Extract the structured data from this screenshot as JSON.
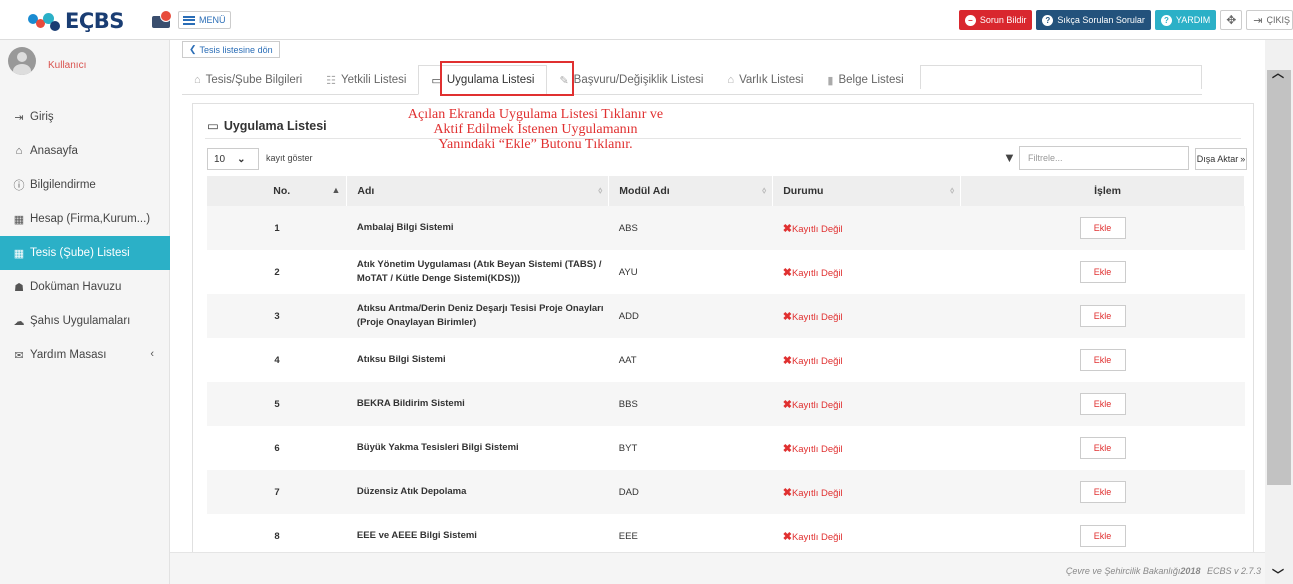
{
  "header": {
    "logo_text": "EÇBS",
    "menu_label": "MENÜ",
    "buttons": {
      "report_issue": "Sorun Bildir",
      "faq": "Sıkça Sorulan Sorular",
      "help": "YARDIM",
      "logout": "ÇIKIŞ"
    }
  },
  "sidebar": {
    "user_name": "Kullanıcı",
    "items": [
      {
        "label": "Giriş",
        "icon": "login-icon"
      },
      {
        "label": "Anasayfa",
        "icon": "home-icon"
      },
      {
        "label": "Bilgilendirme",
        "icon": "info-icon"
      },
      {
        "label": "Hesap (Firma,Kurum...)",
        "icon": "building-icon"
      },
      {
        "label": "Tesis (Şube) Listesi",
        "icon": "building-icon",
        "active": true
      },
      {
        "label": "Doküman Havuzu",
        "icon": "users-icon"
      },
      {
        "label": "Şahıs Uygulamaları",
        "icon": "cloud-icon"
      },
      {
        "label": "Yardım Masası",
        "icon": "envelope-icon"
      }
    ]
  },
  "main": {
    "back_label": "Tesis listesine dön",
    "tabs": [
      {
        "label": "Tesis/Şube Bilgileri"
      },
      {
        "label": "Yetkili Listesi"
      },
      {
        "label": "Uygulama Listesi",
        "active": true
      },
      {
        "label": "Başvuru/Değişiklik Listesi"
      },
      {
        "label": "Varlık Listesi"
      },
      {
        "label": "Belge Listesi"
      }
    ],
    "panel_title": "Uygulama Listesi",
    "annotation": [
      "Açılan Ekranda Uygulama Listesi Tıklanır ve",
      "Aktif Edilmek İstenen Uygulamanın",
      "Yanındaki “Ekle” Butonu Tıklanır."
    ],
    "page_length": "10",
    "page_length_label": "kayıt göster",
    "filter_placeholder": "Filtrele...",
    "export_label": "Dışa Aktar",
    "columns": {
      "no": "No.",
      "name": "Adı",
      "module": "Modül Adı",
      "status": "Durumu",
      "action": "İşlem"
    },
    "rows": [
      {
        "no": "1",
        "name": "Ambalaj Bilgi Sistemi",
        "module": "ABS",
        "status": "Kayıtlı Değil",
        "action": "Ekle"
      },
      {
        "no": "2",
        "name": "Atık Yönetim Uygulaması (Atık Beyan Sistemi (TABS) / MoTAT / Kütle Denge Sistemi(KDS)))",
        "module": "AYU",
        "status": "Kayıtlı Değil",
        "action": "Ekle"
      },
      {
        "no": "3",
        "name": "Atıksu Arıtma/Derin Deniz Deşarjı Tesisi Proje Onayları (Proje Onaylayan Birimler)",
        "module": "ADD",
        "status": "Kayıtlı Değil",
        "action": "Ekle"
      },
      {
        "no": "4",
        "name": "Atıksu Bilgi Sistemi",
        "module": "AAT",
        "status": "Kayıtlı Değil",
        "action": "Ekle"
      },
      {
        "no": "5",
        "name": "BEKRA Bildirim Sistemi",
        "module": "BBS",
        "status": "Kayıtlı Değil",
        "action": "Ekle"
      },
      {
        "no": "6",
        "name": "Büyük Yakma Tesisleri Bilgi Sistemi",
        "module": "BYT",
        "status": "Kayıtlı Değil",
        "action": "Ekle"
      },
      {
        "no": "7",
        "name": "Düzensiz Atık Depolama",
        "module": "DAD",
        "status": "Kayıtlı Değil",
        "action": "Ekle"
      },
      {
        "no": "8",
        "name": "EEE ve AEEE Bilgi Sistemi",
        "module": "EEE",
        "status": "Kayıtlı Değil",
        "action": "Ekle"
      }
    ]
  },
  "footer": {
    "ministry": "Çevre ve Şehircilik Bakanlığı",
    "year": "2018",
    "version": "ECBS v 2.7.3"
  },
  "colors": {
    "accent": "#2bb0c7",
    "danger": "#e03030",
    "brand": "#1a3d73"
  }
}
